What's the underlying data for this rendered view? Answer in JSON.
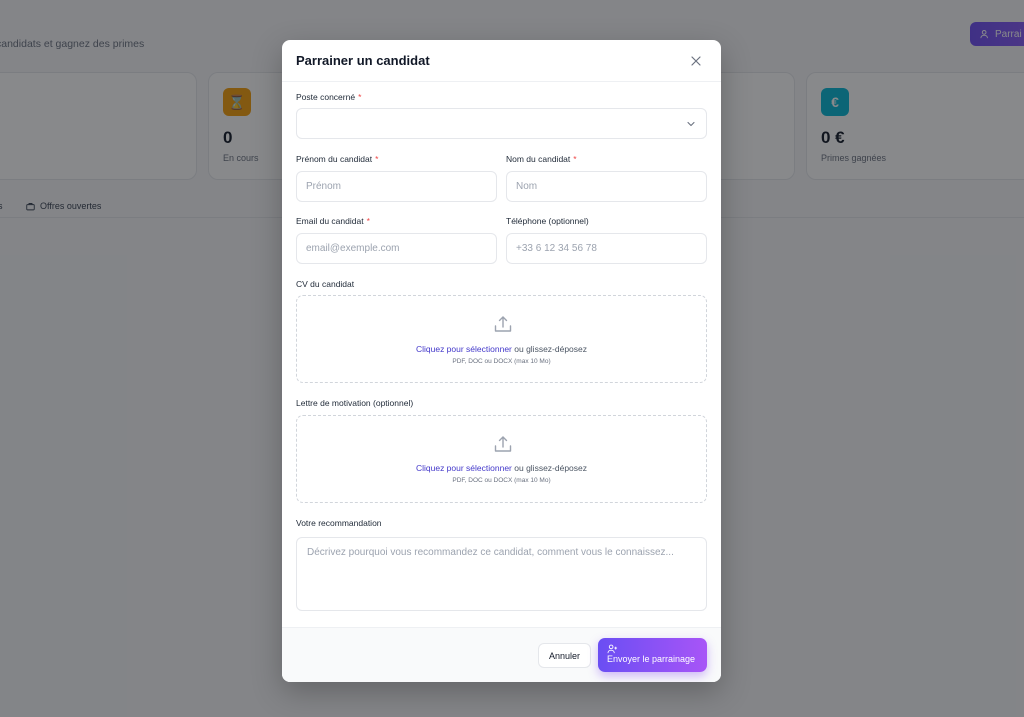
{
  "background": {
    "subtitle": "candidats et gagnez des primes",
    "top_button_label": "Parrai",
    "cards": [
      {
        "value": "0",
        "label": "En cours",
        "icon": "hourglass-icon",
        "color": "#f59e0b"
      },
      {
        "value": "0 €",
        "label": "Primes gagnées",
        "icon": "euro-icon",
        "color": "#06b6d4"
      }
    ],
    "tabs": [
      {
        "label": "s"
      },
      {
        "label": "Offres ouvertes"
      }
    ]
  },
  "modal": {
    "title": "Parrainer un candidat",
    "fields": {
      "poste": {
        "label": "Poste concerné",
        "value": ""
      },
      "prenom": {
        "label": "Prénom du candidat",
        "placeholder": "Prénom"
      },
      "nom": {
        "label": "Nom du candidat",
        "placeholder": "Nom"
      },
      "email": {
        "label": "Email du candidat",
        "placeholder": "email@exemple.com"
      },
      "telephone": {
        "label": "Téléphone (optionnel)",
        "placeholder": "+33 6 12 34 56 78"
      },
      "cv": {
        "label": "CV du candidat",
        "link": "Cliquez pour sélectionner",
        "rest": " ou glissez-déposez",
        "hint": "PDF, DOC ou DOCX (max 10 Mo)"
      },
      "lettre": {
        "label": "Lettre de motivation (optionnel)",
        "link": "Cliquez pour sélectionner",
        "rest": " ou glissez-déposez",
        "hint": "PDF, DOC ou DOCX (max 10 Mo)"
      },
      "recommandation": {
        "label": "Votre recommandation",
        "placeholder": "Décrivez pourquoi vous recommandez ce candidat, comment vous le connaissez..."
      }
    },
    "required_mark": "*",
    "buttons": {
      "cancel": "Annuler",
      "submit": "Envoyer le parrainage"
    }
  },
  "colors": {
    "accent": "#6d4df2",
    "required": "#ef4444",
    "link": "#4338ca"
  }
}
